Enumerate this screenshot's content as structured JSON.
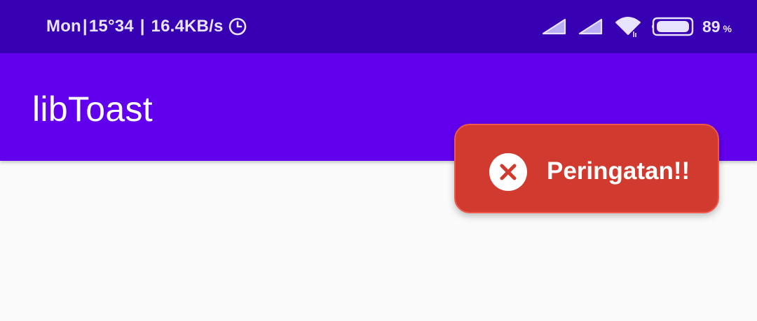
{
  "status_bar": {
    "day": "Mon",
    "time": "15°34",
    "speed": "16.4KB/s",
    "separator": "|",
    "battery_level": "89",
    "battery_unit": "%",
    "icons": [
      "clock-icon",
      "signal-icon",
      "signal-icon",
      "wifi-icon",
      "battery-icon"
    ]
  },
  "app_bar": {
    "title": "libToast"
  },
  "toast": {
    "message": "Peringatan!!",
    "icon": "error-x-icon",
    "background_color": "#d13a2e"
  },
  "colors": {
    "status_bar": "#3700b3",
    "app_bar": "#6200ee",
    "background": "#fafafa"
  }
}
